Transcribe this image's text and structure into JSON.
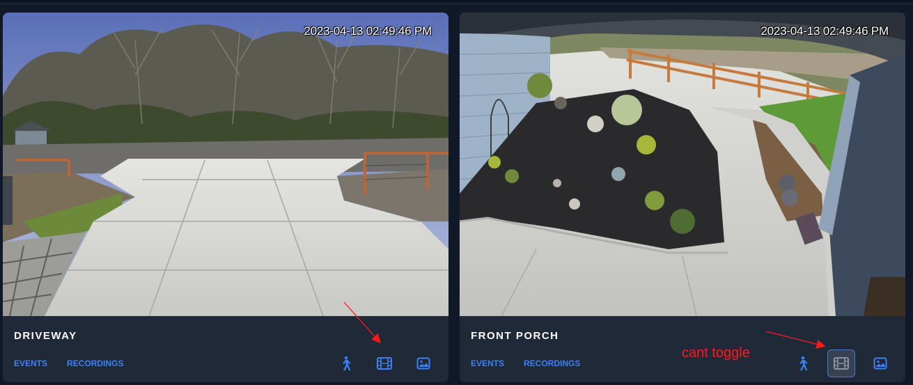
{
  "cameras": [
    {
      "name": "DRIVEWAY",
      "timestamp": "2023-04-13 02:49:46 PM",
      "events_label": "EVENTS",
      "recordings_label": "RECORDINGS",
      "icons": [
        "motion-icon",
        "recordings-film-icon",
        "snapshot-icon"
      ]
    },
    {
      "name": "FRONT PORCH",
      "timestamp": "2023-04-13 02:49:46 PM",
      "events_label": "EVENTS",
      "recordings_label": "RECORDINGS",
      "icons": [
        "motion-icon",
        "recordings-film-icon",
        "snapshot-icon"
      ]
    }
  ],
  "annotation": {
    "text": "cant toggle",
    "color": "#ff1a1a"
  },
  "colors": {
    "accent": "#3b82f6",
    "card": "#1f2937",
    "background": "#111827"
  }
}
